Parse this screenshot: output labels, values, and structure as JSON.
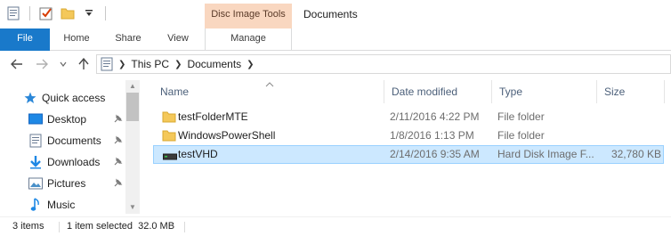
{
  "window": {
    "title": "Documents",
    "context_tab_group": "Disc Image Tools"
  },
  "ribbon": {
    "tabs": [
      {
        "label": "File"
      },
      {
        "label": "Home"
      },
      {
        "label": "Share"
      },
      {
        "label": "View"
      },
      {
        "label": "Manage"
      }
    ]
  },
  "address": {
    "crumbs": [
      "This PC",
      "Documents"
    ]
  },
  "nav": {
    "quick_access": "Quick access",
    "items": [
      {
        "label": "Desktop",
        "icon": "desktop-icon",
        "pinned": true
      },
      {
        "label": "Documents",
        "icon": "documents-icon",
        "pinned": true
      },
      {
        "label": "Downloads",
        "icon": "downloads-icon",
        "pinned": true
      },
      {
        "label": "Pictures",
        "icon": "pictures-icon",
        "pinned": true
      },
      {
        "label": "Music",
        "icon": "music-icon",
        "pinned": false
      }
    ]
  },
  "list": {
    "columns": [
      "Name",
      "Date modified",
      "Type",
      "Size"
    ],
    "rows": [
      {
        "name": "testFolderMTE",
        "date": "2/11/2016 4:22 PM",
        "type": "File folder",
        "size": "",
        "icon": "folder-icon",
        "selected": false
      },
      {
        "name": "WindowsPowerShell",
        "date": "1/8/2016 1:13 PM",
        "type": "File folder",
        "size": "",
        "icon": "folder-icon",
        "selected": false
      },
      {
        "name": "testVHD",
        "date": "2/14/2016 9:35 AM",
        "type": "Hard Disk Image F...",
        "size": "32,780 KB",
        "icon": "vhd-icon",
        "selected": true
      }
    ]
  },
  "status": {
    "count": "3 items",
    "selection": "1 item selected  32.0 MB"
  },
  "colors": {
    "file_tab": "#1979ca",
    "context_tab": "#f9d7c0",
    "selection_bg": "#cce8ff",
    "selection_border": "#99d1ff",
    "folder": "#f4c85a"
  }
}
